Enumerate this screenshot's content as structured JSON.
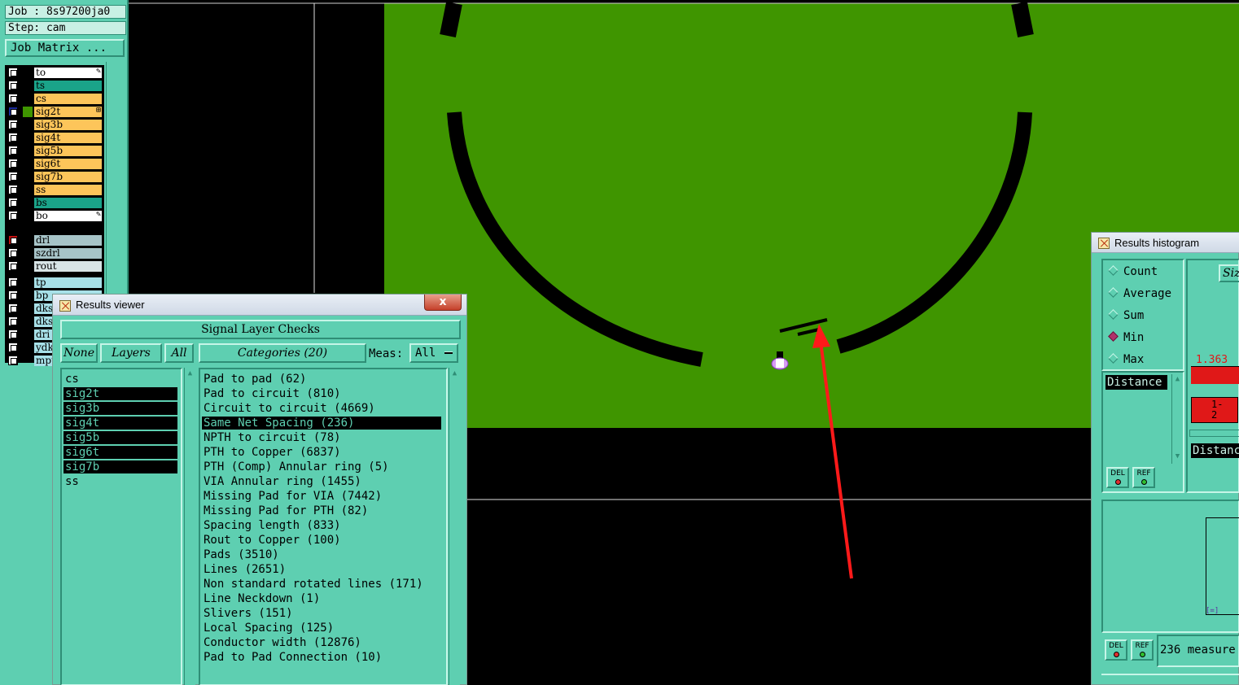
{
  "job_panel": {
    "job_label": "Job : 8s97200ja0",
    "step_label": "Step: cam",
    "job_matrix_button": "Job Matrix ...",
    "layers": [
      {
        "name": "to",
        "color": "#ffffff",
        "icon": "pencil-icon"
      },
      {
        "name": "ts",
        "color": "#1aa389",
        "icon": ""
      },
      {
        "name": "cs",
        "color": "#fdc55a",
        "icon": ""
      },
      {
        "name": "sig2t",
        "color": "#fdc55a",
        "icon": "grid-icon",
        "active": true
      },
      {
        "name": "sig3b",
        "color": "#fdc55a",
        "icon": ""
      },
      {
        "name": "sig4t",
        "color": "#fdc55a",
        "icon": ""
      },
      {
        "name": "sig5b",
        "color": "#fdc55a",
        "icon": ""
      },
      {
        "name": "sig6t",
        "color": "#fdc55a",
        "icon": ""
      },
      {
        "name": "sig7b",
        "color": "#fdc55a",
        "icon": ""
      },
      {
        "name": "ss",
        "color": "#fdc55a",
        "icon": ""
      },
      {
        "name": "bs",
        "color": "#1aa389",
        "icon": ""
      },
      {
        "name": "bo",
        "color": "#ffffff",
        "icon": "pencil-icon"
      },
      {
        "name": "drl",
        "color": "#a7c4c8",
        "icon": "",
        "marker": "red"
      },
      {
        "name": "szdrl",
        "color": "#a7c4c8",
        "icon": ""
      },
      {
        "name": "rout",
        "color": "#d8e4e6",
        "icon": ""
      },
      {
        "name": "tp",
        "color": "#a7e0e8",
        "icon": ""
      },
      {
        "name": "bp",
        "color": "#a7e0e8",
        "icon": ""
      },
      {
        "name": "dks",
        "color": "#a7e0e8",
        "icon": ""
      },
      {
        "name": "dks",
        "color": "#a7e0e8",
        "icon": ""
      },
      {
        "name": "dri",
        "color": "#a7e0e8",
        "icon": ""
      },
      {
        "name": "ydk",
        "color": "#a7e0e8",
        "icon": ""
      },
      {
        "name": "mpt",
        "color": "#a7e0e8",
        "icon": ""
      }
    ]
  },
  "canvas": {
    "board_color": "#3f9500",
    "background_color": "#000000",
    "annotation_color": "#ff1a1a"
  },
  "results_viewer": {
    "title": "Results viewer",
    "close_label": "x",
    "header": "Signal Layer Checks",
    "none_button": "None",
    "layers_button": "Layers",
    "all_button": "All",
    "categories_button": "Categories (20)",
    "meas_label": "Meas:",
    "meas_value": "All",
    "layers": [
      {
        "name": "cs",
        "selected": false
      },
      {
        "name": "sig2t",
        "selected": true
      },
      {
        "name": "sig3b",
        "selected": true
      },
      {
        "name": "sig4t",
        "selected": true
      },
      {
        "name": "sig5b",
        "selected": true
      },
      {
        "name": "sig6t",
        "selected": true
      },
      {
        "name": "sig7b",
        "selected": true
      },
      {
        "name": "ss",
        "selected": false
      }
    ],
    "categories": [
      {
        "label": "Pad to pad (62)",
        "selected": false
      },
      {
        "label": "Pad to circuit (810)",
        "selected": false
      },
      {
        "label": "Circuit to circuit (4669)",
        "selected": false
      },
      {
        "label": "Same Net Spacing (236)",
        "selected": true
      },
      {
        "label": "NPTH to circuit (78)",
        "selected": false
      },
      {
        "label": "PTH to Copper (6837)",
        "selected": false
      },
      {
        "label": "PTH (Comp) Annular ring (5)",
        "selected": false
      },
      {
        "label": "VIA Annular ring (1455)",
        "selected": false
      },
      {
        "label": "Missing Pad for VIA (7442)",
        "selected": false
      },
      {
        "label": "Missing Pad for PTH (82)",
        "selected": false
      },
      {
        "label": "Spacing length (833)",
        "selected": false
      },
      {
        "label": "Rout to Copper (100)",
        "selected": false
      },
      {
        "label": "Pads (3510)",
        "selected": false
      },
      {
        "label": "Lines (2651)",
        "selected": false
      },
      {
        "label": "Non standard rotated lines (171)",
        "selected": false
      },
      {
        "label": "Line Neckdown (1)",
        "selected": false
      },
      {
        "label": "Slivers (151)",
        "selected": false
      },
      {
        "label": "Local Spacing (125)",
        "selected": false
      },
      {
        "label": "Conductor width (12876)",
        "selected": false
      },
      {
        "label": "Pad to Pad Connection (10)",
        "selected": false
      }
    ]
  },
  "results_histogram": {
    "title": "Results histogram",
    "options": [
      {
        "label": "Count",
        "selected": false
      },
      {
        "label": "Average",
        "selected": false
      },
      {
        "label": "Sum",
        "selected": false
      },
      {
        "label": "Min",
        "selected": true
      },
      {
        "label": "Max",
        "selected": false
      }
    ],
    "list_item": "Distance",
    "size_button": "Siz",
    "bar_value": "1.363",
    "bar_range": "1-\n2",
    "distance_label": "Distanc",
    "del_label": "DEL",
    "ref_label": "REF",
    "status": "236 measure",
    "corner_mark": "[=]"
  }
}
